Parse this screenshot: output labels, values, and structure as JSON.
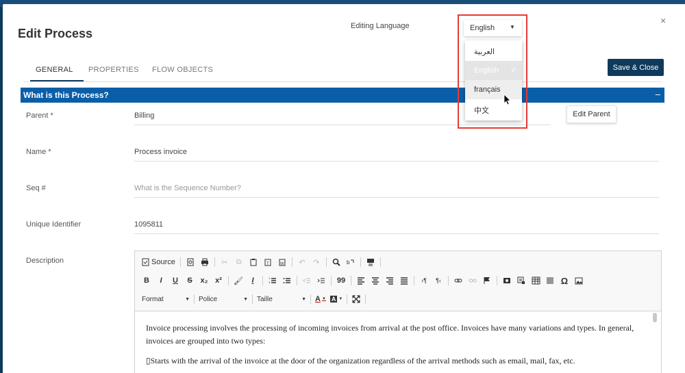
{
  "modal": {
    "title": "Edit Process",
    "editing_language_label": "Editing Language",
    "close_glyph": "×",
    "save_close_label": "Save & Close"
  },
  "language_select": {
    "value": "English",
    "arrow": "▼",
    "options": [
      {
        "label": "العربية"
      },
      {
        "label": "English",
        "selected": true
      },
      {
        "label": "français",
        "hovered": true
      },
      {
        "label": "中文"
      }
    ],
    "check_glyph": "✓"
  },
  "tabs": [
    {
      "label": "GENERAL",
      "active": true
    },
    {
      "label": "PROPERTIES"
    },
    {
      "label": "FLOW OBJECTS"
    }
  ],
  "section": {
    "title": "What is this Process?",
    "collapse_glyph": "–"
  },
  "fields": {
    "parent": {
      "label": "Parent  *",
      "value": "Billing",
      "button": "Edit Parent"
    },
    "name": {
      "label": "Name *",
      "value": "Process invoice"
    },
    "seq": {
      "label": "Seq #",
      "placeholder": "What is the Sequence Number?"
    },
    "uid": {
      "label": "Unique Identifier",
      "value": "1095811"
    },
    "description": {
      "label": "Description"
    }
  },
  "editor": {
    "toolbar_row1": {
      "source_label": "Source"
    },
    "toolbar_row2": {
      "bold": "B",
      "italic": "I",
      "underline": "U",
      "strike": "S",
      "subscript": "x₂",
      "superscript": "x²",
      "omega": "Ω"
    },
    "toolbar_row3": {
      "format": "Format",
      "font": "Police",
      "size": "Taille",
      "text_color": "A",
      "bg_color": "A"
    },
    "combo_arrow": "▼",
    "paragraphs": [
      "Invoice processing involves the processing of incoming invoices from arrival at the post office. Invoices have many variations and types. In general, invoices are grouped into two types:",
      "Starts with the arrival of the invoice at the door of the organization regardless of the arrival methods such as email, mail, fax, etc."
    ],
    "bullet_glyph": "▯"
  },
  "colors": {
    "brand_navy": "#0e3a5c",
    "section_blue": "#0a5ea8",
    "highlight_red": "#e53a35"
  }
}
